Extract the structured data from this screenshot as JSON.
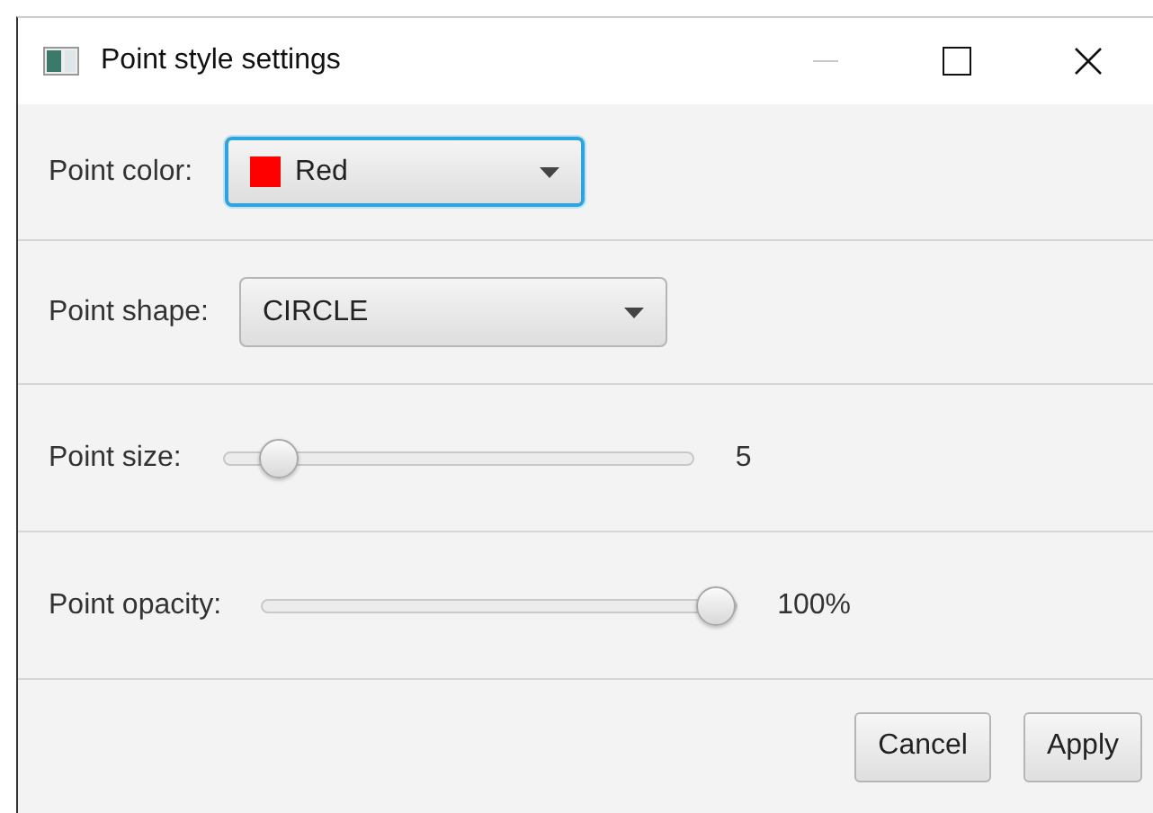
{
  "window": {
    "title": "Point style settings",
    "minimize_disabled": true
  },
  "color_row": {
    "label": "Point color:",
    "value": "Red",
    "color": "#ff0000",
    "focused": true
  },
  "shape_row": {
    "label": "Point shape:",
    "value": "CIRCLE",
    "focused": false
  },
  "sliders": [
    {
      "label": "Point size:",
      "level": 0.08,
      "reading": "5"
    },
    {
      "label": "Point opacity:",
      "level": 1,
      "reading": "100%"
    }
  ],
  "buttons": [
    "Cancel",
    "Apply"
  ]
}
